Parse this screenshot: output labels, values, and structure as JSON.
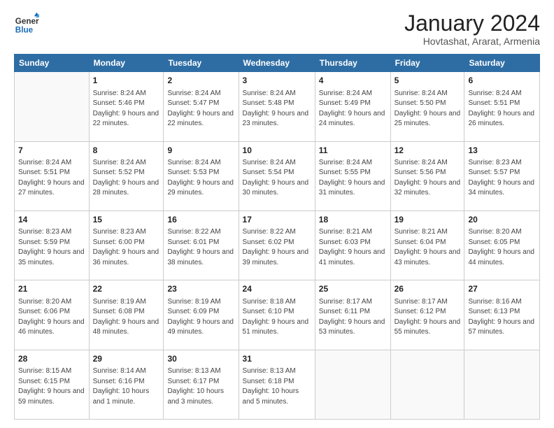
{
  "header": {
    "logo_general": "General",
    "logo_blue": "Blue",
    "month_title": "January 2024",
    "location": "Hovtashat, Ararat, Armenia"
  },
  "days_of_week": [
    "Sunday",
    "Monday",
    "Tuesday",
    "Wednesday",
    "Thursday",
    "Friday",
    "Saturday"
  ],
  "weeks": [
    [
      {
        "day": "",
        "sunrise": "",
        "sunset": "",
        "daylight": "",
        "empty": true
      },
      {
        "day": "1",
        "sunrise": "Sunrise: 8:24 AM",
        "sunset": "Sunset: 5:46 PM",
        "daylight": "Daylight: 9 hours and 22 minutes."
      },
      {
        "day": "2",
        "sunrise": "Sunrise: 8:24 AM",
        "sunset": "Sunset: 5:47 PM",
        "daylight": "Daylight: 9 hours and 22 minutes."
      },
      {
        "day": "3",
        "sunrise": "Sunrise: 8:24 AM",
        "sunset": "Sunset: 5:48 PM",
        "daylight": "Daylight: 9 hours and 23 minutes."
      },
      {
        "day": "4",
        "sunrise": "Sunrise: 8:24 AM",
        "sunset": "Sunset: 5:49 PM",
        "daylight": "Daylight: 9 hours and 24 minutes."
      },
      {
        "day": "5",
        "sunrise": "Sunrise: 8:24 AM",
        "sunset": "Sunset: 5:50 PM",
        "daylight": "Daylight: 9 hours and 25 minutes."
      },
      {
        "day": "6",
        "sunrise": "Sunrise: 8:24 AM",
        "sunset": "Sunset: 5:51 PM",
        "daylight": "Daylight: 9 hours and 26 minutes."
      }
    ],
    [
      {
        "day": "7",
        "sunrise": "Sunrise: 8:24 AM",
        "sunset": "Sunset: 5:51 PM",
        "daylight": "Daylight: 9 hours and 27 minutes."
      },
      {
        "day": "8",
        "sunrise": "Sunrise: 8:24 AM",
        "sunset": "Sunset: 5:52 PM",
        "daylight": "Daylight: 9 hours and 28 minutes."
      },
      {
        "day": "9",
        "sunrise": "Sunrise: 8:24 AM",
        "sunset": "Sunset: 5:53 PM",
        "daylight": "Daylight: 9 hours and 29 minutes."
      },
      {
        "day": "10",
        "sunrise": "Sunrise: 8:24 AM",
        "sunset": "Sunset: 5:54 PM",
        "daylight": "Daylight: 9 hours and 30 minutes."
      },
      {
        "day": "11",
        "sunrise": "Sunrise: 8:24 AM",
        "sunset": "Sunset: 5:55 PM",
        "daylight": "Daylight: 9 hours and 31 minutes."
      },
      {
        "day": "12",
        "sunrise": "Sunrise: 8:24 AM",
        "sunset": "Sunset: 5:56 PM",
        "daylight": "Daylight: 9 hours and 32 minutes."
      },
      {
        "day": "13",
        "sunrise": "Sunrise: 8:23 AM",
        "sunset": "Sunset: 5:57 PM",
        "daylight": "Daylight: 9 hours and 34 minutes."
      }
    ],
    [
      {
        "day": "14",
        "sunrise": "Sunrise: 8:23 AM",
        "sunset": "Sunset: 5:59 PM",
        "daylight": "Daylight: 9 hours and 35 minutes."
      },
      {
        "day": "15",
        "sunrise": "Sunrise: 8:23 AM",
        "sunset": "Sunset: 6:00 PM",
        "daylight": "Daylight: 9 hours and 36 minutes."
      },
      {
        "day": "16",
        "sunrise": "Sunrise: 8:22 AM",
        "sunset": "Sunset: 6:01 PM",
        "daylight": "Daylight: 9 hours and 38 minutes."
      },
      {
        "day": "17",
        "sunrise": "Sunrise: 8:22 AM",
        "sunset": "Sunset: 6:02 PM",
        "daylight": "Daylight: 9 hours and 39 minutes."
      },
      {
        "day": "18",
        "sunrise": "Sunrise: 8:21 AM",
        "sunset": "Sunset: 6:03 PM",
        "daylight": "Daylight: 9 hours and 41 minutes."
      },
      {
        "day": "19",
        "sunrise": "Sunrise: 8:21 AM",
        "sunset": "Sunset: 6:04 PM",
        "daylight": "Daylight: 9 hours and 43 minutes."
      },
      {
        "day": "20",
        "sunrise": "Sunrise: 8:20 AM",
        "sunset": "Sunset: 6:05 PM",
        "daylight": "Daylight: 9 hours and 44 minutes."
      }
    ],
    [
      {
        "day": "21",
        "sunrise": "Sunrise: 8:20 AM",
        "sunset": "Sunset: 6:06 PM",
        "daylight": "Daylight: 9 hours and 46 minutes."
      },
      {
        "day": "22",
        "sunrise": "Sunrise: 8:19 AM",
        "sunset": "Sunset: 6:08 PM",
        "daylight": "Daylight: 9 hours and 48 minutes."
      },
      {
        "day": "23",
        "sunrise": "Sunrise: 8:19 AM",
        "sunset": "Sunset: 6:09 PM",
        "daylight": "Daylight: 9 hours and 49 minutes."
      },
      {
        "day": "24",
        "sunrise": "Sunrise: 8:18 AM",
        "sunset": "Sunset: 6:10 PM",
        "daylight": "Daylight: 9 hours and 51 minutes."
      },
      {
        "day": "25",
        "sunrise": "Sunrise: 8:17 AM",
        "sunset": "Sunset: 6:11 PM",
        "daylight": "Daylight: 9 hours and 53 minutes."
      },
      {
        "day": "26",
        "sunrise": "Sunrise: 8:17 AM",
        "sunset": "Sunset: 6:12 PM",
        "daylight": "Daylight: 9 hours and 55 minutes."
      },
      {
        "day": "27",
        "sunrise": "Sunrise: 8:16 AM",
        "sunset": "Sunset: 6:13 PM",
        "daylight": "Daylight: 9 hours and 57 minutes."
      }
    ],
    [
      {
        "day": "28",
        "sunrise": "Sunrise: 8:15 AM",
        "sunset": "Sunset: 6:15 PM",
        "daylight": "Daylight: 9 hours and 59 minutes."
      },
      {
        "day": "29",
        "sunrise": "Sunrise: 8:14 AM",
        "sunset": "Sunset: 6:16 PM",
        "daylight": "Daylight: 10 hours and 1 minute."
      },
      {
        "day": "30",
        "sunrise": "Sunrise: 8:13 AM",
        "sunset": "Sunset: 6:17 PM",
        "daylight": "Daylight: 10 hours and 3 minutes."
      },
      {
        "day": "31",
        "sunrise": "Sunrise: 8:13 AM",
        "sunset": "Sunset: 6:18 PM",
        "daylight": "Daylight: 10 hours and 5 minutes."
      },
      {
        "day": "",
        "sunrise": "",
        "sunset": "",
        "daylight": "",
        "empty": true
      },
      {
        "day": "",
        "sunrise": "",
        "sunset": "",
        "daylight": "",
        "empty": true
      },
      {
        "day": "",
        "sunrise": "",
        "sunset": "",
        "daylight": "",
        "empty": true
      }
    ]
  ]
}
